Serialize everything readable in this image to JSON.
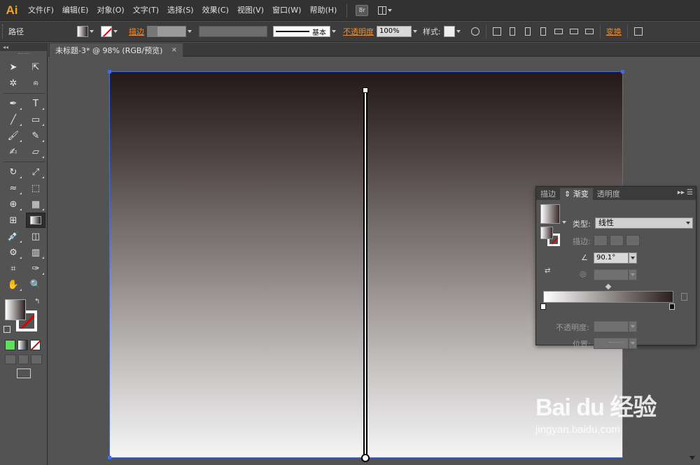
{
  "app": {
    "logo": "Ai"
  },
  "menubar": {
    "items": [
      "文件(F)",
      "编辑(E)",
      "对象(O)",
      "文字(T)",
      "选择(S)",
      "效果(C)",
      "视图(V)",
      "窗口(W)",
      "帮助(H)"
    ],
    "bridge_label": "Br"
  },
  "controlbar": {
    "selection_type": "路径",
    "stroke_link": "描边",
    "stroke_profile": "基本",
    "opacity_link": "不透明度",
    "opacity_value": "100%",
    "style_label": "样式:",
    "transform_link": "变换"
  },
  "document": {
    "tab_title": "未标题-3* @ 98% (RGB/预览)",
    "close_glyph": "×"
  },
  "gradient_panel": {
    "tabs": [
      "描边",
      "渐变",
      "透明度"
    ],
    "active_tab": "渐变",
    "type_label": "类型:",
    "type_value": "线性",
    "stroke_label": "描边:",
    "angle_value": "90.1°",
    "opacity_label": "不透明度:",
    "location_label": "位置:",
    "start_color": "#ffffff",
    "end_color": "#2a1e1e"
  },
  "canvas": {
    "artboard_top_color": "#241818",
    "artboard_bottom_color": "#f6f6f6",
    "selection_color": "#4a6cd8"
  },
  "watermark": {
    "brand": "Bai du 经验",
    "url": "jingyan.baidu.com"
  }
}
